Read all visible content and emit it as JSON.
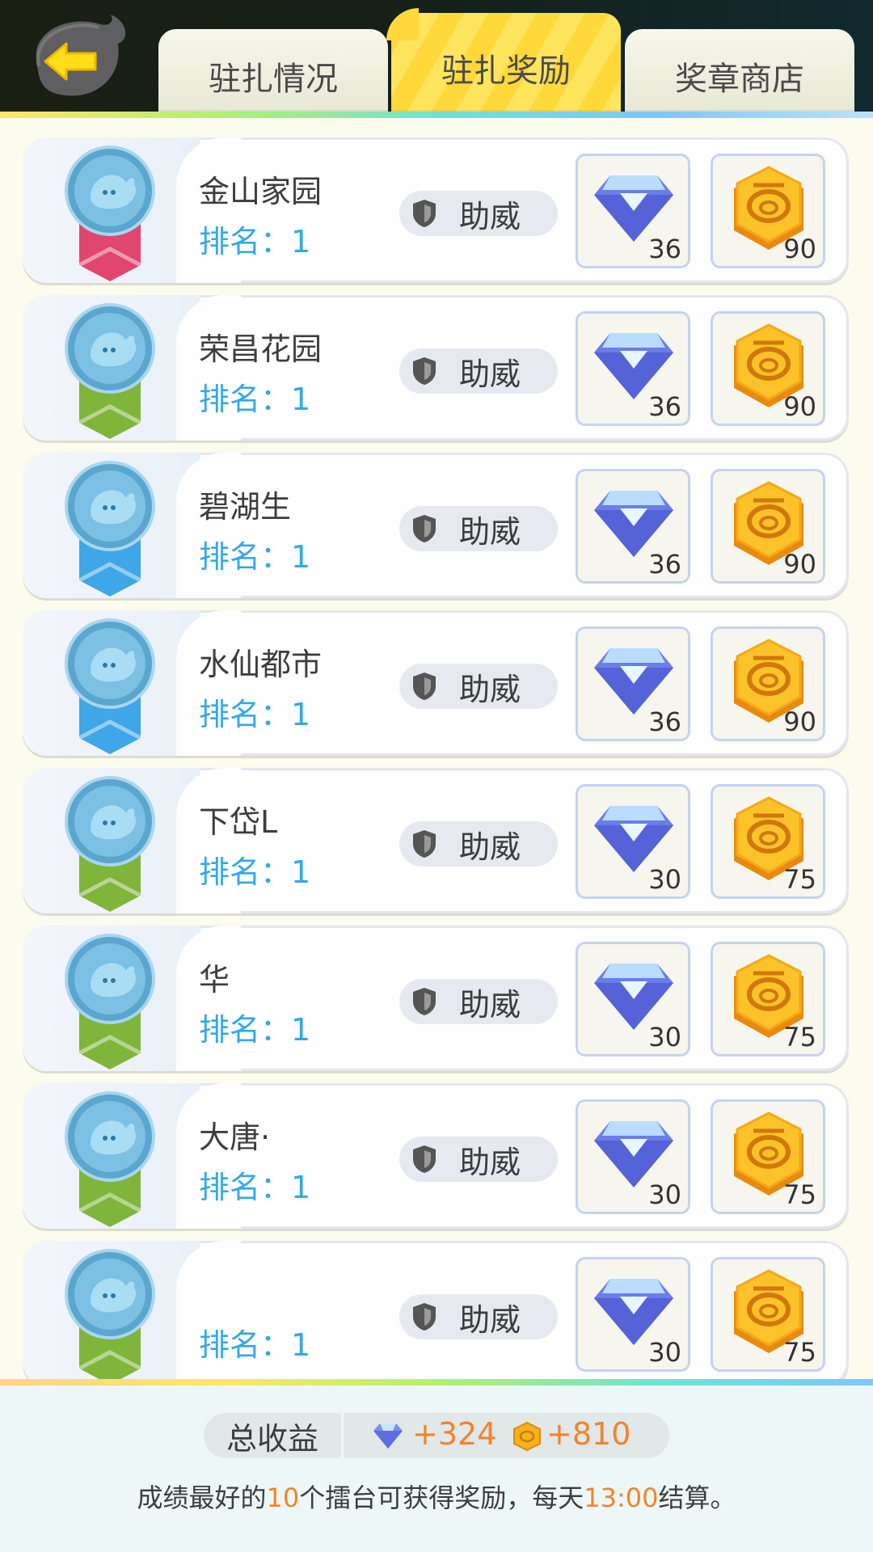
{
  "tabs": [
    {
      "label": "驻扎情况",
      "active": false
    },
    {
      "label": "驻扎奖励",
      "active": true
    },
    {
      "label": "奖章商店",
      "active": false
    }
  ],
  "support_label": "助威",
  "rank_prefix": "排名：",
  "rows": [
    {
      "name": "金山家园",
      "rank": "1",
      "ribbon": "#e0466e",
      "gems": "36",
      "coins": "90"
    },
    {
      "name": "荣昌花园",
      "rank": "1",
      "ribbon": "#7fb53b",
      "gems": "36",
      "coins": "90"
    },
    {
      "name": "碧湖生",
      "rank": "1",
      "ribbon": "#3fa6e8",
      "gems": "36",
      "coins": "90"
    },
    {
      "name": "水仙都市",
      "rank": "1",
      "ribbon": "#3fa6e8",
      "gems": "36",
      "coins": "90"
    },
    {
      "name": "下岱L",
      "rank": "1",
      "ribbon": "#7fb53b",
      "gems": "30",
      "coins": "75"
    },
    {
      "name": "华",
      "rank": "1",
      "ribbon": "#7fb53b",
      "gems": "30",
      "coins": "75"
    },
    {
      "name": "大唐·",
      "rank": "1",
      "ribbon": "#7fb53b",
      "gems": "30",
      "coins": "75"
    },
    {
      "name": "",
      "rank": "1",
      "ribbon": "#7fb53b",
      "gems": "30",
      "coins": "75"
    }
  ],
  "footer": {
    "total_label": "总收益",
    "total_gems": "+324",
    "total_coins": "+810",
    "note_part1": "成绩最好的",
    "note_count": "10",
    "note_part2": "个擂台可获得奖励，每天",
    "note_time": "13:00",
    "note_part3": "结算。"
  },
  "icons": [
    "back-arrow-icon",
    "medal-icon",
    "shield-icon",
    "gem-icon",
    "coin-icon"
  ]
}
